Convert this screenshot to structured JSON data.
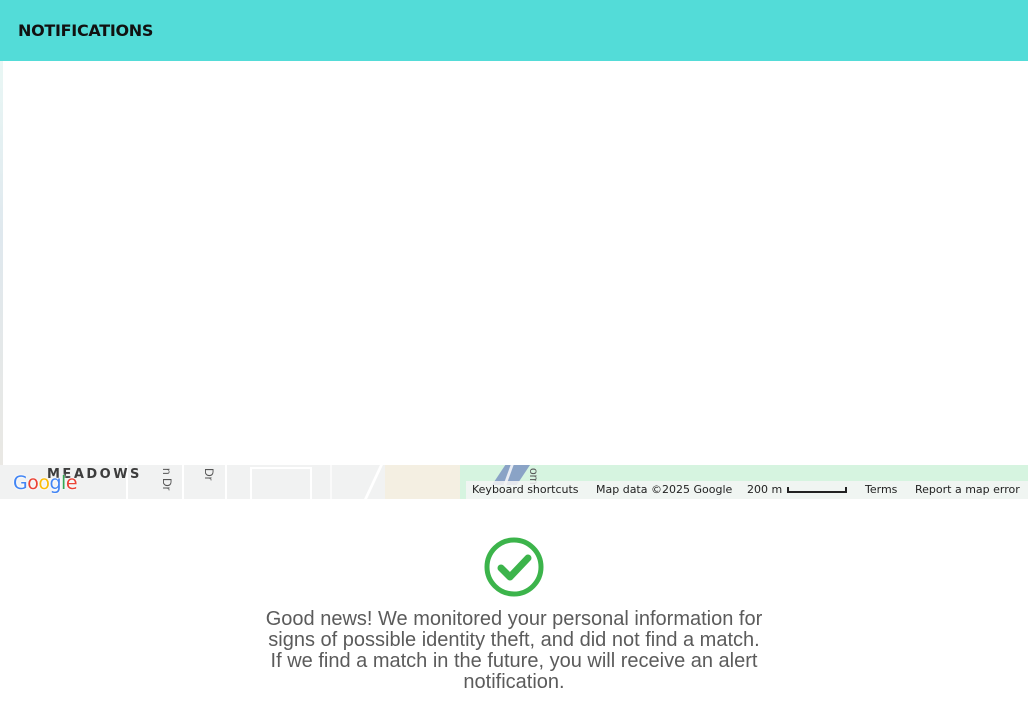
{
  "header": {
    "title": "NOTIFICATIONS",
    "background": "#53dcd8"
  },
  "map": {
    "labels": {
      "meadows": "MEADOWS",
      "street1": "n Dr",
      "street2": "Dr",
      "street3": "om"
    },
    "logo": [
      "G",
      "o",
      "o",
      "g",
      "l",
      "e"
    ],
    "attribution": {
      "keyboard": "Keyboard shortcuts",
      "data": "Map data ©2025 Google",
      "scale": "200 m",
      "terms": "Terms",
      "report": "Report a map error"
    }
  },
  "status": {
    "icon": "check-circle-icon",
    "color": "#3cb44b",
    "lines": [
      "Good news! We monitored your personal information for",
      "signs of possible identity theft, and did not find a match.",
      "If we find a match in the future, you will receive an alert",
      "notification."
    ]
  }
}
